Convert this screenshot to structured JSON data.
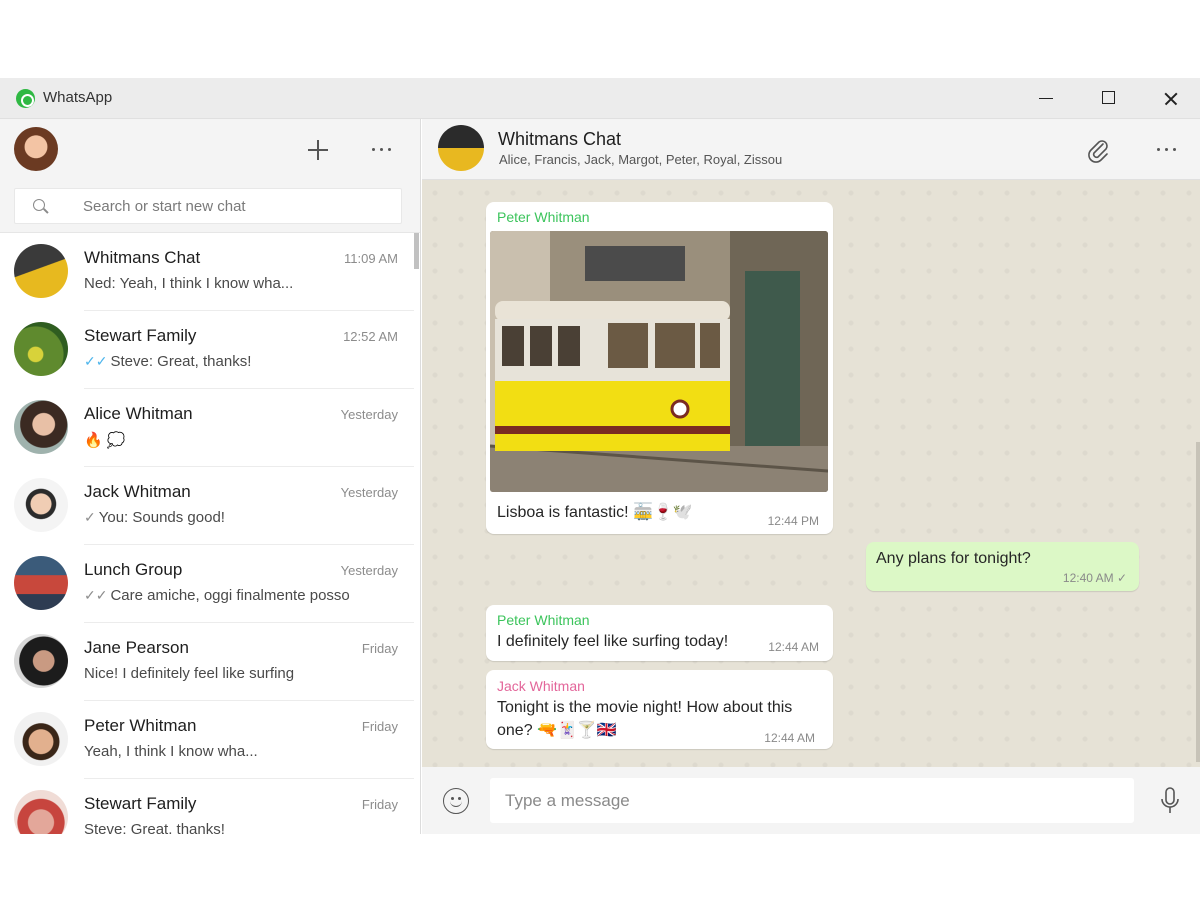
{
  "window": {
    "app_title": "WhatsApp",
    "controls": [
      "minimize-icon",
      "maximize-icon",
      "close-icon"
    ]
  },
  "sidebar": {
    "search_placeholder": "Search or start new chat",
    "chats": [
      {
        "name": "Whitmans Chat",
        "time": "11:09 AM",
        "preview": "Ned: Yeah, I think I know wha...",
        "tick": ""
      },
      {
        "name": "Stewart Family",
        "time": "12:52 AM",
        "preview": "Steve: Great, thanks!",
        "tick": "✓✓"
      },
      {
        "name": "Alice Whitman",
        "time": "Yesterday",
        "preview": "🔥 💭",
        "tick": ""
      },
      {
        "name": "Jack Whitman",
        "time": "Yesterday",
        "preview": "You: Sounds good!",
        "tick": "✓"
      },
      {
        "name": "Lunch Group",
        "time": "Yesterday",
        "preview": "Care amiche, oggi finalmente posso",
        "tick": "✓✓"
      },
      {
        "name": "Jane Pearson",
        "time": "Friday",
        "preview": "Nice! I definitely feel like surfing",
        "tick": ""
      },
      {
        "name": "Peter Whitman",
        "time": "Friday",
        "preview": "Yeah, I think I know wha...",
        "tick": ""
      },
      {
        "name": "Stewart Family",
        "time": "Friday",
        "preview": "Steve: Great, thanks!",
        "tick": ""
      }
    ]
  },
  "chat": {
    "title": "Whitmans Chat",
    "members": "Alice, Francis, Jack, Margot, Peter, Royal, Zissou",
    "messages": [
      {
        "sender": "Peter Whitman",
        "text": "Lisboa is fantastic! 🚋🍷🕊️",
        "time": "12:44 PM"
      },
      {
        "sender": "",
        "text": "Any plans for tonight?",
        "time": "12:40 AM ✓"
      },
      {
        "sender": "Peter Whitman",
        "text": "I definitely feel like surfing today!",
        "time": "12:44 AM"
      },
      {
        "sender": "Jack Whitman",
        "text": "Tonight is the movie night! How about this one? 🔫🃏🍸🇬🇧",
        "time": "12:44 AM"
      }
    ],
    "compose_placeholder": "Type a message"
  },
  "colors": {
    "sender_peter": "#3cc45c",
    "sender_jack": "#e3669a",
    "outgoing_bubble": "#dcf8c6",
    "chat_background": "#e6e2d6",
    "read_tick": "#4fb6ec"
  }
}
